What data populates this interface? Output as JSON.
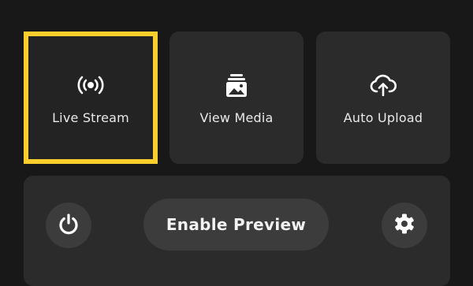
{
  "tiles": {
    "live_stream": {
      "label": "Live Stream",
      "icon": "broadcast-icon",
      "selected": true
    },
    "view_media": {
      "label": "View Media",
      "icon": "media-gallery-icon"
    },
    "auto_upload": {
      "label": "Auto Upload",
      "icon": "cloud-upload-icon"
    }
  },
  "controls": {
    "power_icon": "power-icon",
    "preview_label": "Enable Preview",
    "settings_icon": "gear-icon"
  },
  "colors": {
    "background": "#181818",
    "tile": "#2b2b2b",
    "button": "#3c3c3c",
    "selection_accent": "#fccf2c",
    "text": "#e9e9e9"
  }
}
